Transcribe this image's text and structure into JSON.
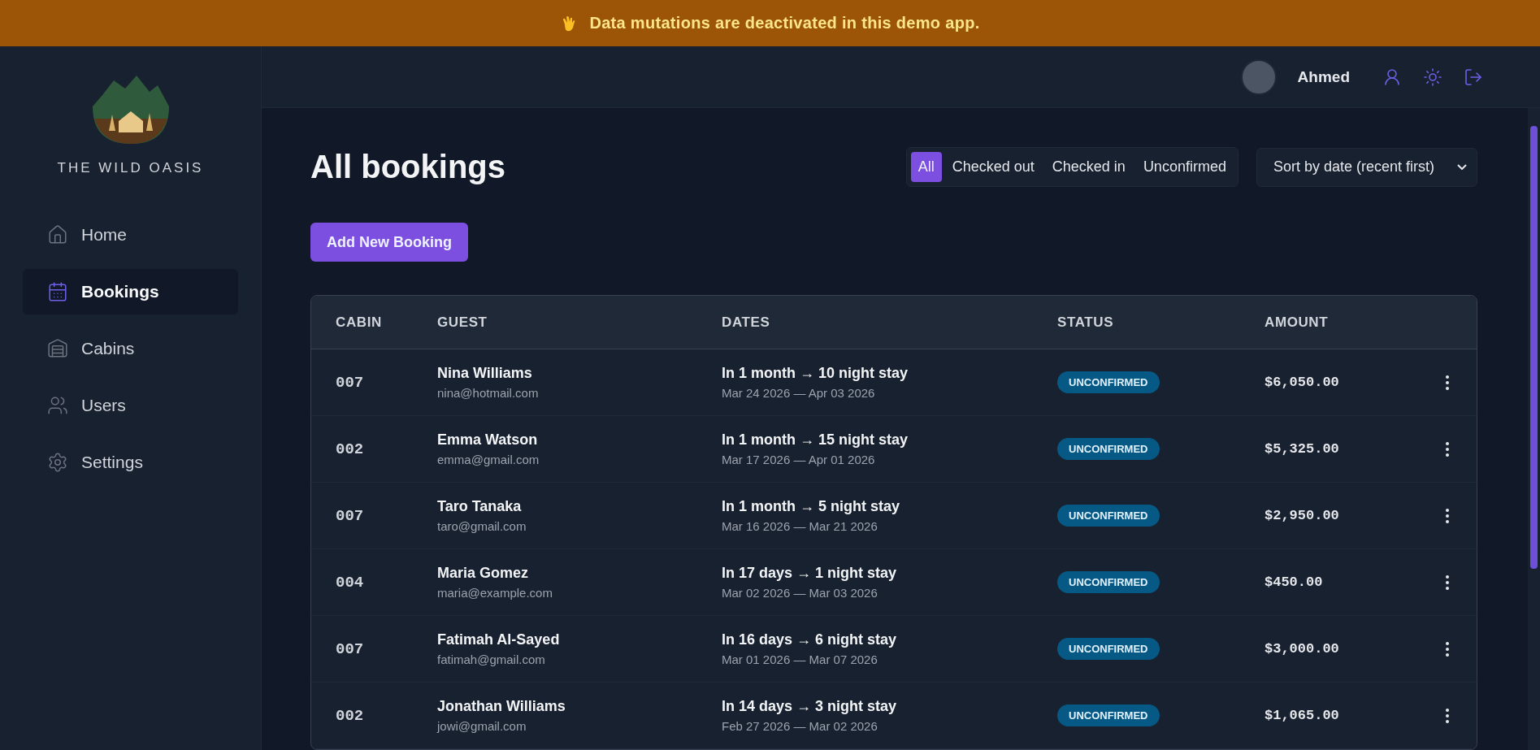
{
  "banner": {
    "text": "Data mutations are deactivated in this demo app."
  },
  "sidebar": {
    "brand": "THE WILD OASIS",
    "items": [
      {
        "label": "Home",
        "selected": false
      },
      {
        "label": "Bookings",
        "selected": true
      },
      {
        "label": "Cabins",
        "selected": false
      },
      {
        "label": "Users",
        "selected": false
      },
      {
        "label": "Settings",
        "selected": false
      }
    ]
  },
  "header": {
    "user": "Ahmed"
  },
  "page": {
    "title": "All bookings",
    "add_button": "Add New Booking",
    "filters": [
      {
        "label": "All",
        "selected": true
      },
      {
        "label": "Checked out",
        "selected": false
      },
      {
        "label": "Checked in",
        "selected": false
      },
      {
        "label": "Unconfirmed",
        "selected": false
      }
    ],
    "sort": {
      "value": "Sort by date (recent first)"
    }
  },
  "table": {
    "columns": [
      "CABIN",
      "GUEST",
      "DATES",
      "STATUS",
      "AMOUNT"
    ],
    "rows": [
      {
        "cabin": "007",
        "guest": "Nina Williams",
        "email": "nina@hotmail.com",
        "stay": "In 1 month → 10 night stay",
        "dates": "Mar 24 2026 — Apr 03 2026",
        "status": {
          "label": "UNCONFIRMED",
          "kind": "unconfirmed"
        },
        "amount": "$6,050.00"
      },
      {
        "cabin": "002",
        "guest": "Emma Watson",
        "email": "emma@gmail.com",
        "stay": "In 1 month → 15 night stay",
        "dates": "Mar 17 2026 — Apr 01 2026",
        "status": {
          "label": "UNCONFIRMED",
          "kind": "unconfirmed"
        },
        "amount": "$5,325.00"
      },
      {
        "cabin": "007",
        "guest": "Taro Tanaka",
        "email": "taro@gmail.com",
        "stay": "In 1 month → 5 night stay",
        "dates": "Mar 16 2026 — Mar 21 2026",
        "status": {
          "label": "UNCONFIRMED",
          "kind": "unconfirmed"
        },
        "amount": "$2,950.00"
      },
      {
        "cabin": "004",
        "guest": "Maria Gomez",
        "email": "maria@example.com",
        "stay": "In 17 days → 1 night stay",
        "dates": "Mar 02 2026 — Mar 03 2026",
        "status": {
          "label": "UNCONFIRMED",
          "kind": "unconfirmed"
        },
        "amount": "$450.00"
      },
      {
        "cabin": "007",
        "guest": "Fatimah Al-Sayed",
        "email": "fatimah@gmail.com",
        "stay": "In 16 days → 6 night stay",
        "dates": "Mar 01 2026 — Mar 07 2026",
        "status": {
          "label": "UNCONFIRMED",
          "kind": "unconfirmed"
        },
        "amount": "$3,000.00"
      },
      {
        "cabin": "002",
        "guest": "Jonathan Williams",
        "email": "jowi@gmail.com",
        "stay": "In 14 days → 3 night stay",
        "dates": "Feb 27 2026 — Mar 02 2026",
        "status": {
          "label": "UNCONFIRMED",
          "kind": "unconfirmed"
        },
        "amount": "$1,065.00"
      }
    ]
  }
}
